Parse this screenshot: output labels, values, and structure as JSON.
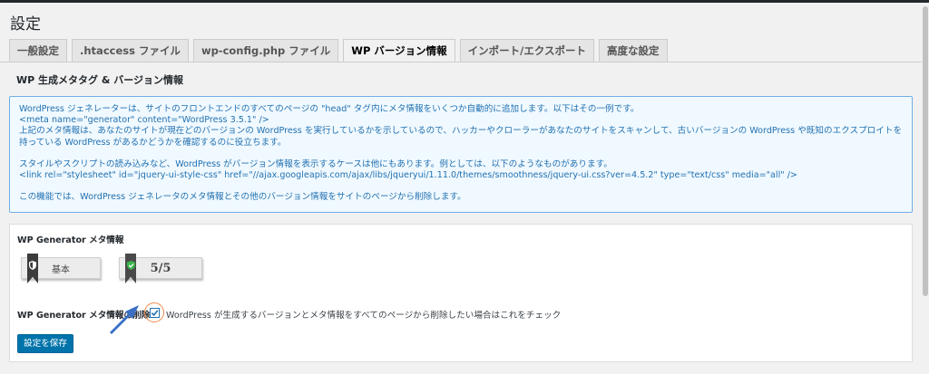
{
  "page": {
    "title": "設定"
  },
  "tabs": [
    {
      "label": "一般設定"
    },
    {
      "label": ".htaccess ファイル"
    },
    {
      "label": "wp-config.php ファイル"
    },
    {
      "label": "WP バージョン情報",
      "active": true
    },
    {
      "label": "インポート/エクスポート"
    },
    {
      "label": "高度な設定"
    }
  ],
  "section": {
    "heading": "WP 生成メタタグ & バージョン情報"
  },
  "info": {
    "line1": "WordPress ジェネレーターは、サイトのフロントエンドのすべてのページの \"head\" タグ内にメタ情報をいくつか自動的に追加します。以下はその一例です。",
    "line2": "<meta name=\"generator\" content=\"WordPress 3.5.1\" />",
    "line3": "上記のメタ情報は、あなたのサイトが現在どのバージョンの WordPress を実行しているかを示しているので、ハッカーやクローラーがあなたのサイトをスキャンして、古いバージョンの WordPress や既知のエクスプロイトを持っている WordPress があるかどうかを確認するのに役立ちます。",
    "line4": "スタイルやスクリプトの読み込みなど、WordPress がバージョン情報を表示するケースは他にもあります。例としては、以下のようなものがあります。",
    "line5": "<link rel=\"stylesheet\" id=\"jquery-ui-style-css\" href=\"//ajax.googleapis.com/ajax/libs/jqueryui/1.11.0/themes/smoothness/jquery-ui.css?ver=4.5.2\" type=\"text/css\" media=\"all\" />",
    "line6": "この機能では、WordPress ジェネレータのメタ情報とその他のバージョン情報をサイトのページから削除します。"
  },
  "card": {
    "title": "WP Generator メタ情報",
    "badge_basic": "基本",
    "badge_score": "5/5",
    "field_label": "WP Generator メタ情報の削除:",
    "checkbox_checked": true,
    "checkbox_text": "WordPress が生成するバージョンとメタ情報をすべてのページから削除したい場合はこれをチェック",
    "save_label": "設定を保存"
  },
  "icons": {
    "ribbon_basic": "shield-icon",
    "ribbon_score": "shield-check-icon",
    "checkbox": "check-icon",
    "pointer": "arrow-icon"
  },
  "colors": {
    "accent": "#0073aa",
    "info_text": "#2271b1",
    "highlight_ring": "#f08a4b"
  }
}
